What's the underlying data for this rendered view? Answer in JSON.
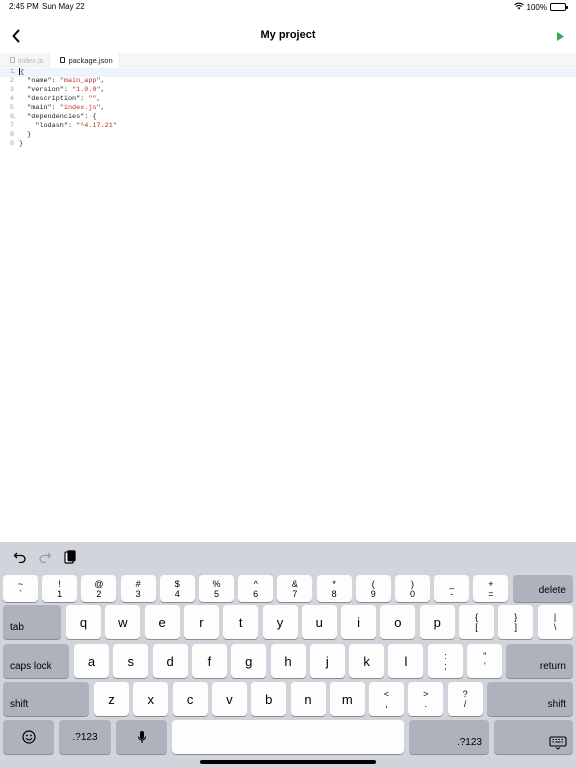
{
  "status": {
    "time": "2:45 PM",
    "date": "Sun May 22",
    "battery": "100%"
  },
  "nav": {
    "title": "My project",
    "back_icon": "chevron-left-icon",
    "run_icon": "play-icon",
    "run_color": "#34a853"
  },
  "tabs": [
    {
      "label": "index.js",
      "active": false
    },
    {
      "label": "package.json",
      "active": true
    }
  ],
  "editor": {
    "lines": [
      {
        "num": "1",
        "fold": "⌄",
        "parts": [
          {
            "t": "{",
            "c": "key"
          }
        ]
      },
      {
        "num": "2",
        "fold": "",
        "parts": [
          {
            "t": "  \"name\": ",
            "c": "key"
          },
          {
            "t": "\"main_app\"",
            "c": "str"
          },
          {
            "t": ",",
            "c": "key"
          }
        ]
      },
      {
        "num": "3",
        "fold": "",
        "parts": [
          {
            "t": "  \"version\": ",
            "c": "key"
          },
          {
            "t": "\"1.0.0\"",
            "c": "str"
          },
          {
            "t": ",",
            "c": "key"
          }
        ]
      },
      {
        "num": "4",
        "fold": "",
        "parts": [
          {
            "t": "  \"description\": ",
            "c": "key"
          },
          {
            "t": "\"\"",
            "c": "str"
          },
          {
            "t": ",",
            "c": "key"
          }
        ]
      },
      {
        "num": "5",
        "fold": "",
        "parts": [
          {
            "t": "  \"main\": ",
            "c": "key"
          },
          {
            "t": "\"index.js\"",
            "c": "str"
          },
          {
            "t": ",",
            "c": "key"
          }
        ]
      },
      {
        "num": "6",
        "fold": "⌄",
        "parts": [
          {
            "t": "  \"dependencies\": {",
            "c": "key"
          }
        ]
      },
      {
        "num": "7",
        "fold": "",
        "parts": [
          {
            "t": "    \"lodash\": ",
            "c": "key"
          },
          {
            "t": "\"^4.17.21\"",
            "c": "str"
          }
        ]
      },
      {
        "num": "8",
        "fold": "",
        "parts": [
          {
            "t": "  }",
            "c": "key"
          }
        ]
      },
      {
        "num": "9",
        "fold": "",
        "parts": [
          {
            "t": "}",
            "c": "key"
          }
        ]
      }
    ]
  },
  "keyboard": {
    "shortcuts": [
      "undo-icon",
      "redo-icon",
      "paste-icon"
    ],
    "number_row": [
      {
        "top": "~",
        "bottom": "`"
      },
      {
        "top": "!",
        "bottom": "1"
      },
      {
        "top": "@",
        "bottom": "2"
      },
      {
        "top": "#",
        "bottom": "3"
      },
      {
        "top": "$",
        "bottom": "4"
      },
      {
        "top": "%",
        "bottom": "5"
      },
      {
        "top": "^",
        "bottom": "6"
      },
      {
        "top": "&",
        "bottom": "7"
      },
      {
        "top": "*",
        "bottom": "8"
      },
      {
        "top": "(",
        "bottom": "9"
      },
      {
        "top": ")",
        "bottom": "0"
      },
      {
        "top": "_",
        "bottom": "-"
      },
      {
        "top": "+",
        "bottom": "="
      }
    ],
    "delete_label": "delete",
    "tab_label": "tab",
    "row_q": [
      "q",
      "w",
      "e",
      "r",
      "t",
      "y",
      "u",
      "i",
      "o",
      "p"
    ],
    "row_q_extra": [
      {
        "top": "{",
        "bottom": "["
      },
      {
        "top": "}",
        "bottom": "]"
      },
      {
        "top": "|",
        "bottom": "\\"
      }
    ],
    "caps_label": "caps lock",
    "row_a": [
      "a",
      "s",
      "d",
      "f",
      "g",
      "h",
      "j",
      "k",
      "l"
    ],
    "row_a_extra": [
      {
        "top": ":",
        "bottom": ";"
      },
      {
        "top": "\"",
        "bottom": "'"
      }
    ],
    "return_label": "return",
    "shift_label": "shift",
    "row_z": [
      "z",
      "x",
      "c",
      "v",
      "b",
      "n",
      "m"
    ],
    "row_z_extra": [
      {
        "top": "<",
        "bottom": ","
      },
      {
        "top": ">",
        "bottom": "."
      },
      {
        "top": "?",
        "bottom": "/"
      }
    ],
    "numbers_label": ".?123"
  }
}
